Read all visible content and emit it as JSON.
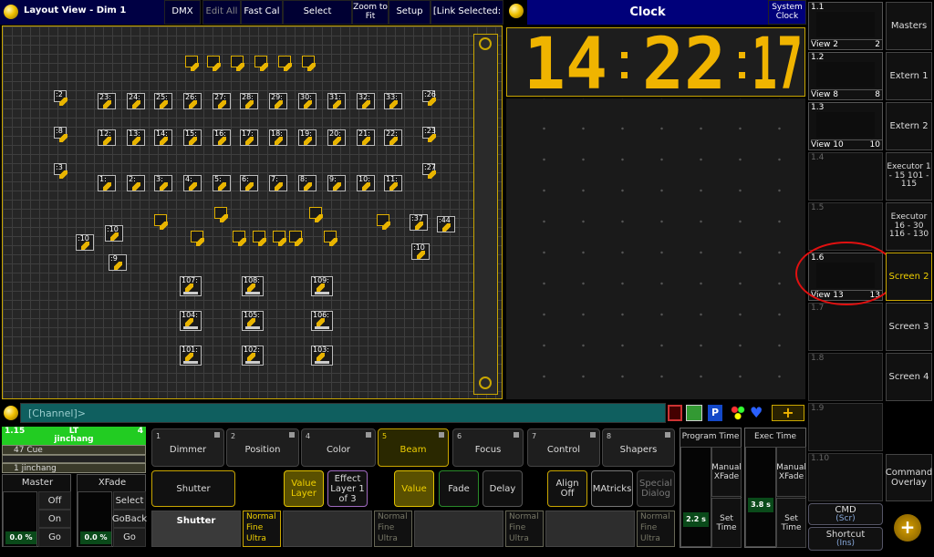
{
  "layout_window": {
    "title": "Layout View - Dim 1",
    "buttons": [
      "DMX",
      "Edit All",
      "Fast Cal",
      "Select",
      "Zoom to Fit",
      "Setup",
      "[Link Selected:"
    ],
    "fixtures_top_row": [
      "",
      "",
      "",
      "",
      "",
      ""
    ],
    "fixtures_row1": [
      "23:",
      "24:",
      "25:",
      "26:",
      "27:",
      "28:",
      "29:",
      "30:",
      "31:",
      "32:",
      "33:"
    ],
    "fixtures_row2": [
      "12:",
      "13:",
      "14:",
      "15:",
      "16:",
      "17:",
      "18:",
      "19:",
      "20:",
      "21:",
      "22:"
    ],
    "fixtures_row3": [
      "1:",
      "2:",
      "3:",
      "4:",
      "5:",
      "6:",
      "7:",
      "8:",
      "9:",
      "10:",
      "11:"
    ],
    "fixtures_left": [
      ":2",
      ":8",
      ":3"
    ],
    "fixtures_right": [
      ":26",
      ":23",
      ":27"
    ],
    "fixtures_misc": [
      ":10",
      ":10",
      ":9",
      ":37",
      ":44",
      ":10"
    ],
    "fixtures_big": [
      "107:",
      "108:",
      "109:",
      "104:",
      "105:",
      "106:",
      "101:",
      "102:",
      "103:"
    ]
  },
  "clock_window": {
    "title": "Clock",
    "system_clock_label": "System Clock",
    "time": "14:22:17",
    "hh": "14",
    "mm": "22",
    "ss": "17"
  },
  "views": [
    {
      "num": "1.1",
      "label": "View 2",
      "index": "2"
    },
    {
      "num": "1.2",
      "label": "View 8",
      "index": "8"
    },
    {
      "num": "1.3",
      "label": "View 10",
      "index": "10"
    },
    {
      "num": "1.4",
      "label": "",
      "index": ""
    },
    {
      "num": "1.5",
      "label": "",
      "index": ""
    },
    {
      "num": "1.6",
      "label": "View 13",
      "index": "13"
    },
    {
      "num": "1.7",
      "label": "",
      "index": ""
    },
    {
      "num": "1.8",
      "label": "",
      "index": ""
    },
    {
      "num": "1.9",
      "label": "",
      "index": ""
    },
    {
      "num": "1.10",
      "label": "",
      "index": ""
    }
  ],
  "screen_buttons": [
    "Masters",
    "Extern 1",
    "Extern 2",
    "Executor 1 - 15 101 - 115",
    "Executor 16 - 30 116 - 130",
    "Screen 2",
    "Screen 3",
    "Screen 4"
  ],
  "command_overlay": "Command Overlay",
  "cmd": {
    "label": "CMD",
    "sub": "(Scr)"
  },
  "shortcut": {
    "label": "Shortcut",
    "sub": "(Ins)"
  },
  "command_line": {
    "prompt": "[Channel]>"
  },
  "executor": {
    "number": "1.15",
    "name": "LT",
    "page": "4",
    "user": "jinchang",
    "cue": "47 Cue",
    "cue2": "1 jinchang"
  },
  "master": {
    "title": "Master",
    "value": "0.0 %",
    "buttons": [
      "Off",
      "On",
      "Go"
    ]
  },
  "xfade": {
    "title": "XFade",
    "value": "0.0 %",
    "buttons": [
      "Select",
      "GoBack",
      "Go"
    ]
  },
  "features": [
    {
      "num": "1",
      "label": "Dimmer"
    },
    {
      "num": "2",
      "label": "Position"
    },
    {
      "num": "4",
      "label": "Color"
    },
    {
      "num": "5",
      "label": "Beam"
    },
    {
      "num": "6",
      "label": "Focus"
    },
    {
      "num": "7",
      "label": "Control"
    },
    {
      "num": "8",
      "label": "Shapers"
    }
  ],
  "attribute": "Shutter",
  "value_layer": "Value Layer",
  "effect_layer": "Effect Layer 1 of 3",
  "value_buttons": [
    "Value",
    "Fade",
    "Delay"
  ],
  "align_off": "Align Off",
  "matricks": "MAtricks",
  "special_dialog": "Special Dialog",
  "encoders": [
    {
      "label": "Shutter",
      "sub": [
        "Normal",
        "Fine",
        "Ultra"
      ]
    },
    {
      "label": "",
      "sub": [
        "Normal",
        "Fine",
        "Ultra"
      ]
    },
    {
      "label": "",
      "sub": [
        "Normal",
        "Fine",
        "Ultra"
      ]
    },
    {
      "label": "",
      "sub": [
        "Normal",
        "Fine",
        "Ultra"
      ]
    }
  ],
  "program_time": {
    "title": "Program Time",
    "manual": "Manual XFade",
    "value": "2.2 s",
    "set": "Set Time"
  },
  "exec_time": {
    "title": "Exec Time",
    "manual": "Manual XFade",
    "value": "3.8 s",
    "set": "Set Time"
  },
  "colors": {
    "accent": "#c9a600",
    "executor_green": "#22cc22",
    "cmdline": "#0f5f5f",
    "annotation_red": "#e01010"
  }
}
